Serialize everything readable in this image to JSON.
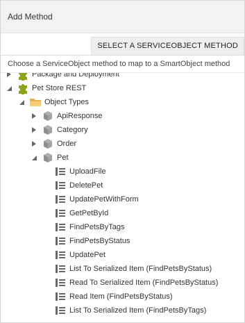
{
  "header": {
    "title": "Add Method"
  },
  "section": {
    "label": "SELECT A SERVICEOBJECT METHOD",
    "instruction": "Choose a ServiceObject method to map to a SmartObject method"
  },
  "tree": {
    "package": {
      "label": "Package and Deployment",
      "icon": "puzzle-icon",
      "expanded": false
    },
    "service": {
      "label": "Pet Store REST",
      "icon": "puzzle-icon",
      "expanded": true
    },
    "object_types": {
      "label": "Object Types",
      "icon": "folder-icon",
      "expanded": true
    },
    "types": [
      {
        "label": "ApiResponse",
        "icon": "cube-icon",
        "expanded": false
      },
      {
        "label": "Category",
        "icon": "cube-icon",
        "expanded": false
      },
      {
        "label": "Order",
        "icon": "cube-icon",
        "expanded": false
      },
      {
        "label": "Pet",
        "icon": "cube-icon",
        "expanded": true
      }
    ],
    "methods": [
      {
        "label": "UploadFile",
        "icon": "method-icon"
      },
      {
        "label": "DeletePet",
        "icon": "method-icon"
      },
      {
        "label": "UpdatePetWithForm",
        "icon": "method-icon"
      },
      {
        "label": "GetPetById",
        "icon": "method-icon"
      },
      {
        "label": "FindPetsByTags",
        "icon": "method-icon"
      },
      {
        "label": "FindPetsByStatus",
        "icon": "method-icon"
      },
      {
        "label": "UpdatePet",
        "icon": "method-icon"
      },
      {
        "label": "List To Serialized Item (FindPetsByStatus)",
        "icon": "method-icon"
      },
      {
        "label": "Read To Serialized Item (FindPetsByStatus)",
        "icon": "method-icon"
      },
      {
        "label": "Read Item (FindPetsByStatus)",
        "icon": "method-icon"
      },
      {
        "label": "List To Serialized Item (FindPetsByTags)",
        "icon": "method-icon"
      }
    ]
  },
  "colors": {
    "puzzle": "#8aa51a",
    "folder": "#e9b24a",
    "cube": "#8e8e8e",
    "method": "#666666",
    "toggle": "#666666"
  }
}
